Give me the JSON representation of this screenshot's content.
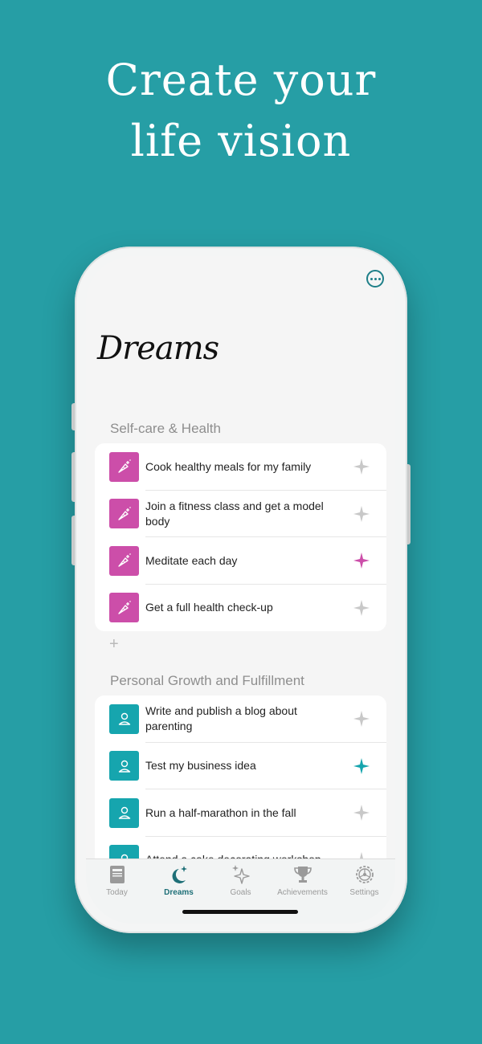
{
  "headline": {
    "line1": "Create your",
    "line2": "life vision"
  },
  "screen": {
    "title": "Dreams",
    "sections": [
      {
        "heading": "Self-care & Health",
        "color": "#cc4ea9",
        "icon": "carrot-icon",
        "items": [
          {
            "label": "Cook healthy meals for my family",
            "starred": false
          },
          {
            "label": "Join a fitness class and get a model body",
            "starred": false
          },
          {
            "label": "Meditate each day",
            "starred": true
          },
          {
            "label": "Get a full health check-up",
            "starred": false
          }
        ],
        "add_label": "+"
      },
      {
        "heading": "Personal Growth and Fulfillment",
        "color": "#16a5ae",
        "icon": "person-icon",
        "items": [
          {
            "label": "Write and publish a blog about parenting",
            "starred": false
          },
          {
            "label": "Test my business idea",
            "starred": true
          },
          {
            "label": "Run a half-marathon in the fall",
            "starred": false
          },
          {
            "label": "Attend a cake decorating workshop",
            "starred": false
          }
        ]
      }
    ],
    "tabs": [
      {
        "label": "Today",
        "icon": "calendar-icon",
        "active": false
      },
      {
        "label": "Dreams",
        "icon": "moon-icon",
        "active": true
      },
      {
        "label": "Goals",
        "icon": "sparkles-icon",
        "active": false
      },
      {
        "label": "Achievements",
        "icon": "trophy-icon",
        "active": false
      },
      {
        "label": "Settings",
        "icon": "gear-icon",
        "active": false
      }
    ]
  },
  "colors": {
    "background": "#269ea5",
    "pink_accent": "#cc4ea9",
    "teal_accent": "#16a5ae",
    "active_tab": "#1e6f77",
    "inactive_star": "#c4c4c4"
  }
}
